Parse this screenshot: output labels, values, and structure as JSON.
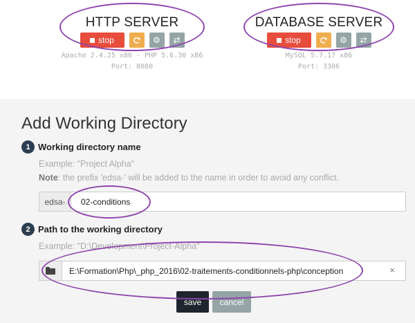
{
  "servers": [
    {
      "title": "HTTP SERVER",
      "stop_label": "stop",
      "info_line1": "Apache 2.4.25 x86 - PHP 5.6.30 x86",
      "info_line2": "Port: 8080"
    },
    {
      "title": "DATABASE SERVER",
      "stop_label": "stop",
      "info_line1": "MySQL 5.7.17 x86",
      "info_line2": "Port: 3306"
    }
  ],
  "form": {
    "title": "Add Working Directory",
    "step1": {
      "number": "1",
      "label": "Working directory name",
      "example": "Example: \"Project Alpha\"",
      "note_label": "Note",
      "note_text": ": the prefix 'edsa-' will be added to the name in order to avoid any conflict.",
      "prefix": "edsa-",
      "value": "02-conditions"
    },
    "step2": {
      "number": "2",
      "label": "Path to the working directory",
      "example": "Example: \"D:\\Development\\Project-Alpha\"",
      "value": "E:\\Formation\\Php\\_php_2016\\02-traitements-conditionnels-php\\conception",
      "clear_glyph": "×"
    },
    "save_label": "save",
    "cancel_label": "cancel"
  },
  "colors": {
    "stop": "#e74c3c",
    "restart": "#f0ad4e",
    "secondary": "#95a5a6",
    "primary_dark": "#1e252c",
    "annotation": "#8e44ad"
  },
  "icons": {
    "stop": "stop-icon",
    "restart": "refresh-icon",
    "settings": "gear-icon",
    "switch": "exchange-icon",
    "folder": "folder-open-icon",
    "clear": "close-icon"
  }
}
